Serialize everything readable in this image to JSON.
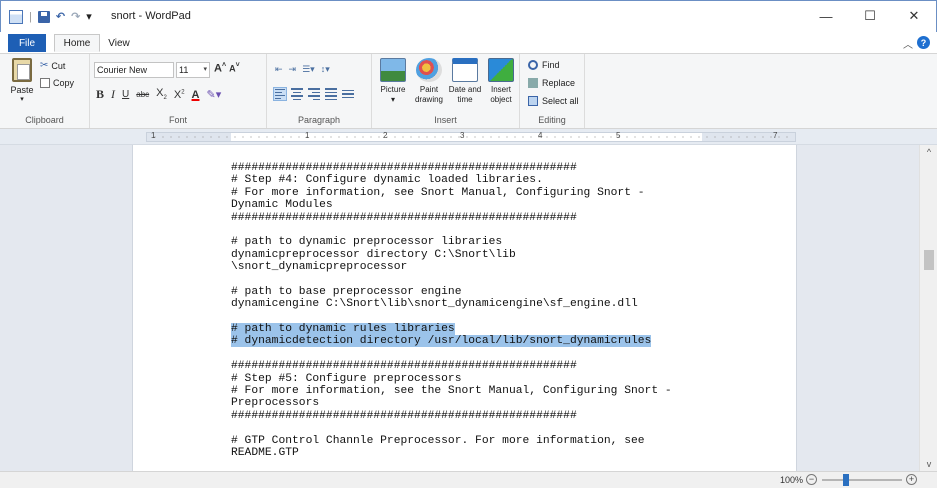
{
  "window": {
    "title": "snort - WordPad",
    "controls": {
      "minimize": "—",
      "maximize": "☐",
      "close": "✕"
    }
  },
  "quick_access": {
    "dropdown": "▾"
  },
  "tabs": {
    "file": "File",
    "home": "Home",
    "view": "View"
  },
  "ribbon": {
    "clipboard": {
      "paste": "Paste",
      "cut": "Cut",
      "copy": "Copy",
      "group": "Clipboard"
    },
    "font": {
      "family": "Courier New",
      "size": "11",
      "grow": "A",
      "shrink": "A",
      "bold": "B",
      "italic": "I",
      "underline": "U",
      "strike": "abc",
      "subscript": "X",
      "superscript": "X",
      "color": "A",
      "group": "Font"
    },
    "paragraph": {
      "group": "Paragraph"
    },
    "insert": {
      "picture": "Picture",
      "paint_line1": "Paint",
      "paint_line2": "drawing",
      "date_line1": "Date and",
      "date_line2": "time",
      "object_line1": "Insert",
      "object_line2": "object",
      "group": "Insert"
    },
    "editing": {
      "find": "Find",
      "replace": "Replace",
      "select_all": "Select all",
      "group": "Editing"
    }
  },
  "ruler": {
    "marks": [
      "1",
      "1",
      "2",
      "3",
      "4",
      "5",
      "7"
    ]
  },
  "document": {
    "lines": [
      {
        "text": "###################################################",
        "selected": false
      },
      {
        "text": "# Step #4: Configure dynamic loaded libraries.",
        "selected": false
      },
      {
        "text": "# For more information, see Snort Manual, Configuring Snort -",
        "selected": false
      },
      {
        "text": "Dynamic Modules",
        "selected": false
      },
      {
        "text": "###################################################",
        "selected": false
      },
      {
        "text": "",
        "selected": false
      },
      {
        "text": "# path to dynamic preprocessor libraries",
        "selected": false
      },
      {
        "text": "dynamicpreprocessor directory C:\\Snort\\lib",
        "selected": false
      },
      {
        "text": "\\snort_dynamicpreprocessor",
        "selected": false
      },
      {
        "text": "",
        "selected": false
      },
      {
        "text": "# path to base preprocessor engine",
        "selected": false
      },
      {
        "text": "dynamicengine C:\\Snort\\lib\\snort_dynamicengine\\sf_engine.dll",
        "selected": false
      },
      {
        "text": "",
        "selected": false
      },
      {
        "text": "# path to dynamic rules libraries",
        "selected": true
      },
      {
        "text": "# dynamicdetection directory /usr/local/lib/snort_dynamicrules",
        "selected": true
      },
      {
        "text": "",
        "selected": false
      },
      {
        "text": "###################################################",
        "selected": false
      },
      {
        "text": "# Step #5: Configure preprocessors",
        "selected": false
      },
      {
        "text": "# For more information, see the Snort Manual, Configuring Snort -",
        "selected": false
      },
      {
        "text": "Preprocessors",
        "selected": false
      },
      {
        "text": "###################################################",
        "selected": false
      },
      {
        "text": "",
        "selected": false
      },
      {
        "text": "# GTP Control Channle Preprocessor. For more information, see",
        "selected": false
      },
      {
        "text": "README.GTP",
        "selected": false
      }
    ]
  },
  "status": {
    "zoom": "100%",
    "zoom_minus": "−",
    "zoom_plus": "+",
    "zoom_level_fraction": 0.3
  }
}
